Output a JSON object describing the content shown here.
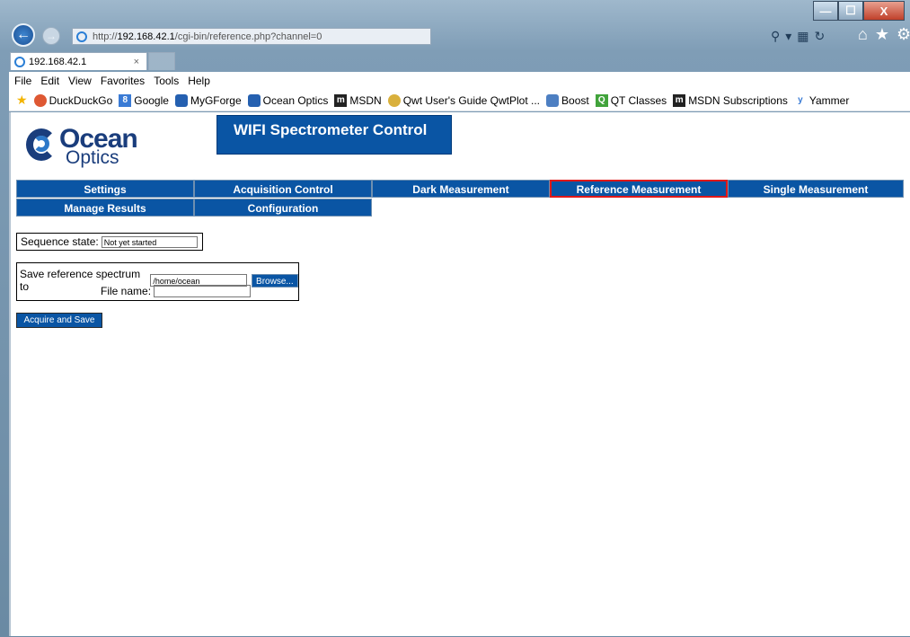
{
  "window": {
    "minimize_glyph": "—",
    "maximize_glyph": "☐",
    "close_glyph": "X"
  },
  "address_bar": {
    "prefix": "http://",
    "host": "192.168.42.1",
    "path": "/cgi-bin/reference.php?channel=0"
  },
  "tab": {
    "label": "192.168.42.1",
    "close_glyph": "×"
  },
  "menu": [
    "File",
    "Edit",
    "View",
    "Favorites",
    "Tools",
    "Help"
  ],
  "favorites": [
    "DuckDuckGo",
    "Google",
    "MyGForge",
    "Ocean Optics",
    "MSDN",
    "Qwt User's Guide QwtPlot ...",
    "Boost",
    "QT Classes",
    "MSDN Subscriptions",
    "Yammer"
  ],
  "logo": {
    "line1": "Ocean",
    "line2": "Optics"
  },
  "page": {
    "title": "WIFI Spectrometer Control",
    "nav": [
      "Settings",
      "Acquisition Control",
      "Dark Measurement",
      "Reference Measurement",
      "Single Measurement",
      "Manage Results",
      "Configuration"
    ],
    "active_tab": "Reference Measurement",
    "sequence_label": "Sequence state:",
    "sequence_value": "Not yet started",
    "save_label": "Save reference spectrum to",
    "save_path": "/home/ocean",
    "browse_label": "Browse...",
    "filename_label": "File name:",
    "filename_value": "",
    "acquire_label": "Acquire and Save"
  },
  "colors": {
    "nav_bg": "#0a55a4",
    "active_border": "#e01818",
    "brand": "#1a3d7c"
  }
}
